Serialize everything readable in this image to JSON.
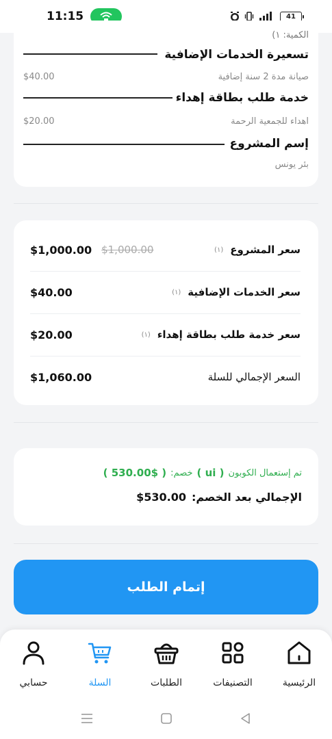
{
  "status_bar": {
    "time": "11:15",
    "battery": "41"
  },
  "items_card": {
    "quantity_label": "الكمية: ١)",
    "additional_services_title": "تسعيرة الخدمات الإضافية",
    "maintenance_desc": "صيانة مدة 2 سنة إضافية",
    "maintenance_price": "$40.00",
    "gift_card_title": "خدمة طلب بطاقة إهداء",
    "gift_desc": "اهداء للجمعية الرحمة",
    "gift_price": "$20.00",
    "project_name_title": "إسم المشروع",
    "project_name": "بئر يونس"
  },
  "prices_card": {
    "rows": [
      {
        "label": "سعر المشروع",
        "qty": "(١)",
        "value": "$1,000.00",
        "old_value": "$1,000.00"
      },
      {
        "label": "سعر الخدمات الإضافية",
        "qty": "(١)",
        "value": "$40.00",
        "old_value": ""
      },
      {
        "label": "سعر خدمة طلب بطاقة إهداء",
        "qty": "(١)",
        "value": "$20.00",
        "old_value": ""
      },
      {
        "label": "السعر الإجمالي للسلة",
        "qty": "",
        "value": "$1,060.00",
        "old_value": ""
      }
    ]
  },
  "coupon_card": {
    "applied_label": "تم إستعمال الكوبون",
    "coupon_code": "( ui )",
    "discount_label": "خصم:",
    "discount_value": "( 530.00$ )",
    "total_after_label": "الإجمالي بعد الخصم:",
    "total_after_value": "$530.00"
  },
  "checkout_button": {
    "label": "إتمام الطلب"
  },
  "bottom_nav": {
    "items": [
      {
        "label": "الرئيسية",
        "icon": "home-icon"
      },
      {
        "label": "التصنيفات",
        "icon": "categories-icon"
      },
      {
        "label": "الطلبات",
        "icon": "orders-basket-icon"
      },
      {
        "label": "السلة",
        "icon": "cart-icon",
        "active": true
      },
      {
        "label": "حسابي",
        "icon": "user-icon"
      }
    ]
  },
  "colors": {
    "primary": "#2196f3",
    "success": "#2fae4f",
    "background": "#f3f4f6",
    "card": "#ffffff"
  }
}
